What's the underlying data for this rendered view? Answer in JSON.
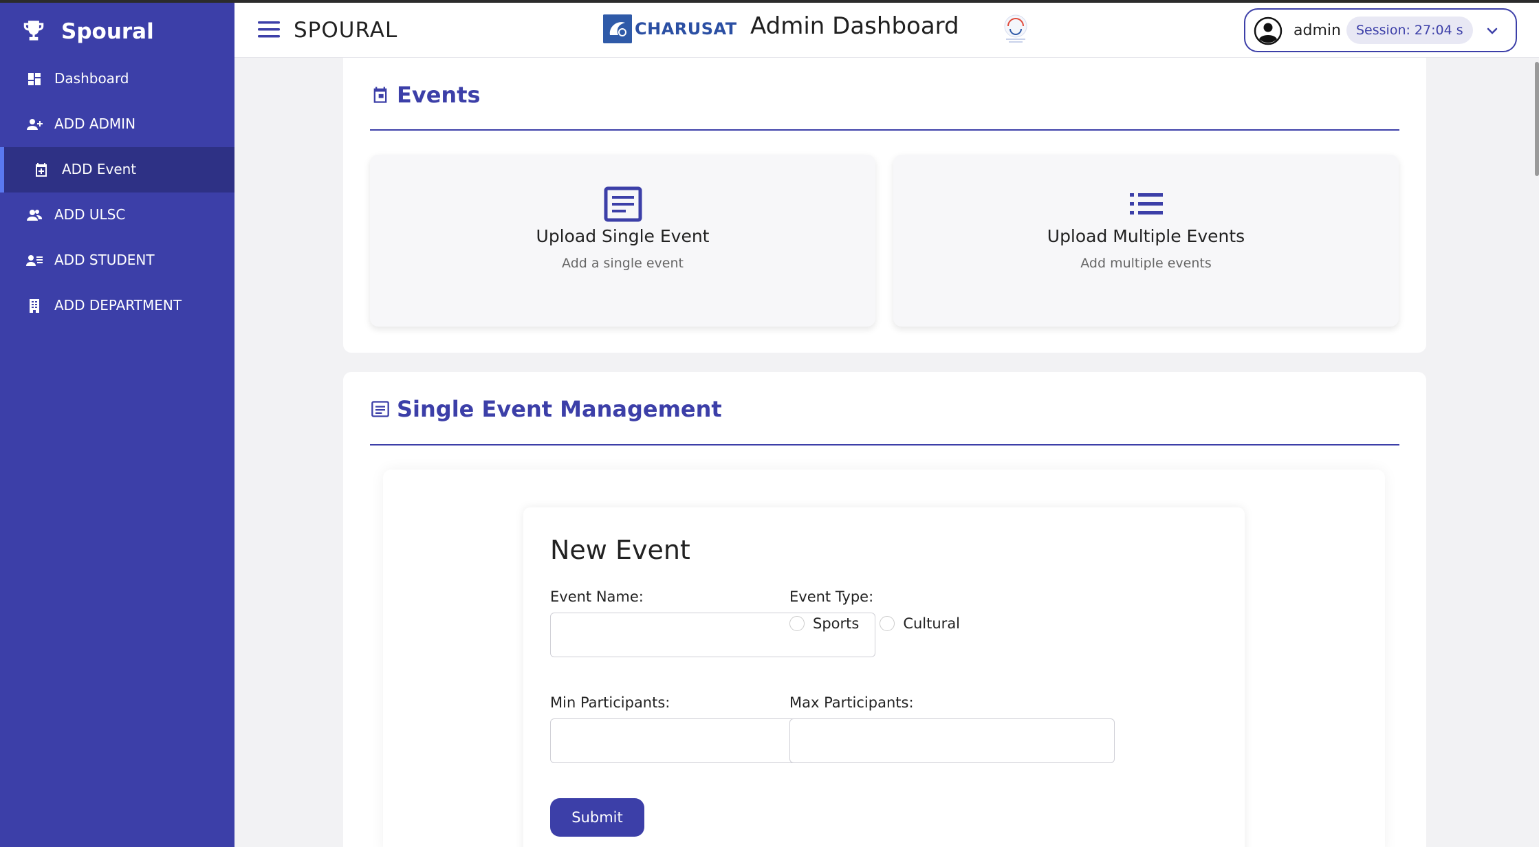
{
  "brand": {
    "name": "Spoural",
    "icon": "trophy-icon"
  },
  "sidebar": {
    "items": [
      {
        "label": "Dashboard",
        "icon": "dashboard-icon"
      },
      {
        "label": "ADD ADMIN",
        "icon": "add-person-icon"
      },
      {
        "label": "ADD Event",
        "icon": "calendar-add-icon",
        "active": true
      },
      {
        "label": "ADD ULSC",
        "icon": "group-icon"
      },
      {
        "label": "ADD STUDENT",
        "icon": "person-list-icon"
      },
      {
        "label": "ADD DEPARTMENT",
        "icon": "building-icon"
      }
    ]
  },
  "header": {
    "app_name": "SPOURAL",
    "charusat_text": "CHARUSAT",
    "title": "Admin Dashboard",
    "user": "admin",
    "session": "Session: 27:04 s"
  },
  "events": {
    "title": "Events",
    "options": [
      {
        "title": "Upload Single Event",
        "subtitle": "Add a single event",
        "icon": "article-icon"
      },
      {
        "title": "Upload Multiple Events",
        "subtitle": "Add multiple events",
        "icon": "list-icon"
      }
    ]
  },
  "management": {
    "title": "Single Event Management",
    "form": {
      "title": "New Event",
      "event_name_label": "Event Name:",
      "event_type_label": "Event Type:",
      "type_options": [
        "Sports",
        "Cultural"
      ],
      "min_label": "Min Participants:",
      "max_label": "Max Participants:",
      "submit_label": "Submit"
    }
  },
  "colors": {
    "primary": "#3c3fa8",
    "sidebar_active": "#2e3185"
  }
}
